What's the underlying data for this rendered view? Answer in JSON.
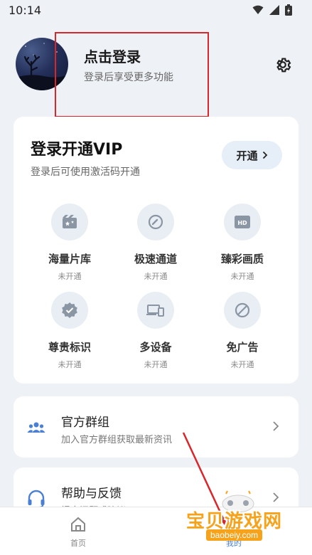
{
  "status_bar": {
    "time": "10:14"
  },
  "header": {
    "title": "点击登录",
    "subtitle": "登录后享受更多功能"
  },
  "vip": {
    "title": "登录开通VIP",
    "subtitle": "登录后可使用激活码开通",
    "open_label": "开通",
    "features": [
      {
        "name": "海量片库",
        "status": "未开通",
        "icon": "film-icon"
      },
      {
        "name": "极速通道",
        "status": "未开通",
        "icon": "speedometer-icon"
      },
      {
        "name": "臻彩画质",
        "status": "未开通",
        "icon": "hd-icon"
      },
      {
        "name": "尊贵标识",
        "status": "未开通",
        "icon": "verified-badge-icon"
      },
      {
        "name": "多设备",
        "status": "未开通",
        "icon": "devices-icon"
      },
      {
        "name": "免广告",
        "status": "未开通",
        "icon": "no-ads-icon"
      }
    ]
  },
  "list": [
    {
      "title": "官方群组",
      "subtitle": "加入官方群组获取最新资讯",
      "icon": "group-icon"
    },
    {
      "title": "帮助与反馈",
      "subtitle": "提交问题或建议",
      "icon": "headset-icon"
    }
  ],
  "bottom_nav": [
    {
      "label": "首页",
      "icon": "home-icon"
    },
    {
      "label": "我的",
      "icon": "profile-icon"
    }
  ],
  "watermark": {
    "text": "宝贝游戏网",
    "url": "baobeiy.com"
  },
  "colors": {
    "accent": "#4a7fd4",
    "highlight": "#d9262b",
    "watermark": "#f6a21b"
  }
}
